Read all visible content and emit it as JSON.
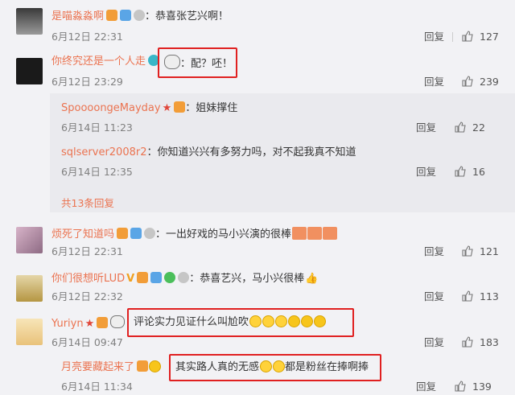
{
  "comments": [
    {
      "name": "是喵淼淼啊",
      "text": "：恭喜张艺兴啊！",
      "time": "6月12日 22:31",
      "reply": "回复",
      "likes": "127"
    },
    {
      "name": "你终究还是一个人走",
      "text": "：配？呸！",
      "time": "6月12日 23:29",
      "reply": "回复",
      "likes": "239"
    },
    {
      "name": "烦死了知道吗",
      "text": "：一出好戏的马小兴演的很棒",
      "time": "6月12日 22:31",
      "reply": "回复",
      "likes": "121"
    },
    {
      "name": "你们很想听LUD",
      "text": "：恭喜艺兴，马小兴很棒",
      "time": "6月12日 22:32",
      "reply": "回复",
      "likes": "113"
    },
    {
      "name": "Yuriyn",
      "text": "评论实力见证什么叫尬吹",
      "time": "6月14日 09:47",
      "reply": "回复",
      "likes": "183"
    },
    {
      "name": "月亮要藏起来了",
      "text_a": "其实路人真的无感",
      "text_b": "都是粉丝在捧啊捧",
      "time": "6月14日 11:34",
      "reply": "回复",
      "likes": "139"
    }
  ],
  "subcomments": [
    {
      "name": "SpoooongeMayday",
      "text": "：姐妹撑住",
      "time": "6月14日 11:23",
      "reply": "回复",
      "likes": "22"
    },
    {
      "name": "sqlserver2008r2",
      "text": "：你知道兴兴有多努力吗，对不起我真不知道",
      "time": "6月14日 12:35",
      "reply": "回复",
      "likes": "16"
    }
  ],
  "more_replies": "共13条回复",
  "colors": {
    "name": "#eb7350",
    "highlight": "#e02020"
  }
}
